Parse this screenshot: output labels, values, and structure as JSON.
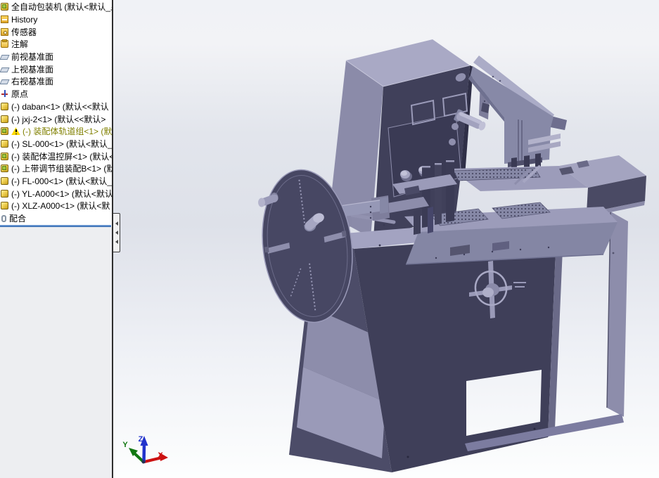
{
  "feature_tree": {
    "items": [
      {
        "label": "全自动包装机 (默认<默认_显",
        "icon": "assembly"
      },
      {
        "label": "History",
        "icon": "history"
      },
      {
        "label": "传感器",
        "icon": "sensors"
      },
      {
        "label": "注解",
        "icon": "annotations"
      },
      {
        "label": "前视基准面",
        "icon": "plane"
      },
      {
        "label": "上视基准面",
        "icon": "plane"
      },
      {
        "label": "右视基准面",
        "icon": "plane"
      },
      {
        "label": "原点",
        "icon": "origin"
      },
      {
        "label": "(-) daban<1> (默认<<默认",
        "icon": "component"
      },
      {
        "label": "(-) jxj-2<1> (默认<<默认>",
        "icon": "component"
      },
      {
        "label": "(-) 装配体轨道组<1> (默",
        "icon": "assembly",
        "warning": true
      },
      {
        "label": "(-) SL-000<1> (默认<默认_",
        "icon": "component"
      },
      {
        "label": "(-) 装配体温控屏<1> (默认<",
        "icon": "assembly"
      },
      {
        "label": "(-) 上带调节组装配B<1> (默",
        "icon": "assembly"
      },
      {
        "label": "(-) FL-000<1> (默认<默认_",
        "icon": "component"
      },
      {
        "label": "(-) YL-A000<1> (默认<默认",
        "icon": "component"
      },
      {
        "label": "(-) XLZ-A000<1> (默认<默",
        "icon": "component"
      },
      {
        "label": "配合",
        "icon": "mates"
      }
    ],
    "warning_text_color": "#808000",
    "splitter_color": "#2f66ac"
  },
  "viewport": {
    "triad": {
      "x": "X",
      "y": "Y",
      "z": "Z",
      "x_color": "#cc1111",
      "y_color": "#117711",
      "z_color": "#2233cc"
    },
    "model": {
      "light_face_color": "#a6a6c2",
      "medium_face_color": "#8a8aa8",
      "dark_face_color": "#40405a"
    },
    "background": {
      "top": "#f2f3f6",
      "middle": "#dee1e9",
      "bottom": "#fdfefe"
    }
  }
}
